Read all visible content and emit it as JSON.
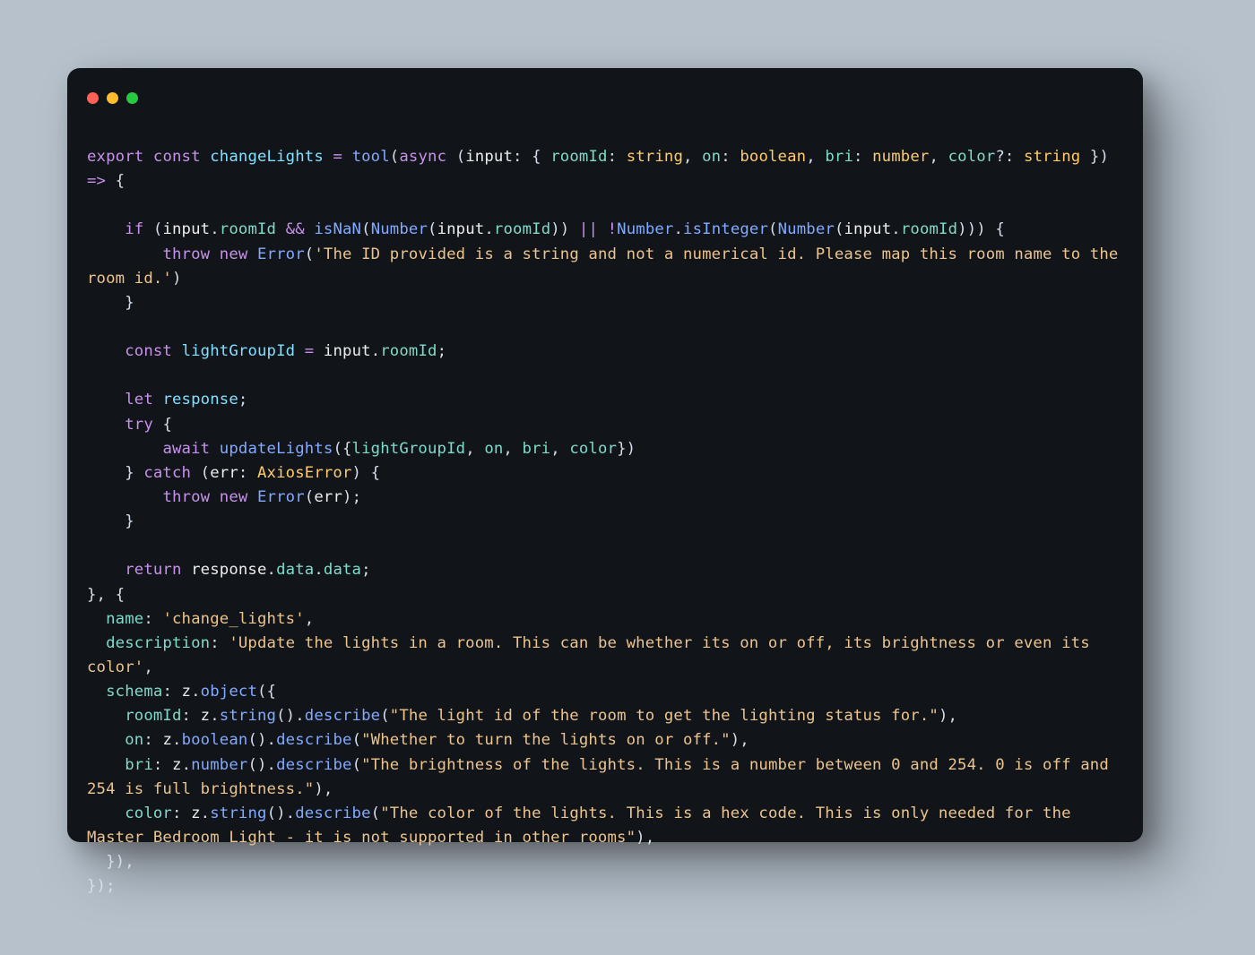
{
  "window": {
    "traffic_lights": [
      "close",
      "minimize",
      "zoom"
    ]
  },
  "code": {
    "tokens": [
      {
        "t": "export",
        "c": "kw"
      },
      {
        "t": " ",
        "c": "punc"
      },
      {
        "t": "const",
        "c": "kw"
      },
      {
        "t": " ",
        "c": "punc"
      },
      {
        "t": "changeLights",
        "c": "decl"
      },
      {
        "t": " ",
        "c": "punc"
      },
      {
        "t": "=",
        "c": "op"
      },
      {
        "t": " ",
        "c": "punc"
      },
      {
        "t": "tool",
        "c": "fn"
      },
      {
        "t": "(",
        "c": "punc"
      },
      {
        "t": "async",
        "c": "kw"
      },
      {
        "t": " (",
        "c": "punc"
      },
      {
        "t": "input",
        "c": "var"
      },
      {
        "t": ": { ",
        "c": "punc"
      },
      {
        "t": "roomId",
        "c": "prop"
      },
      {
        "t": ": ",
        "c": "punc"
      },
      {
        "t": "string",
        "c": "typ"
      },
      {
        "t": ", ",
        "c": "punc"
      },
      {
        "t": "on",
        "c": "prop"
      },
      {
        "t": ": ",
        "c": "punc"
      },
      {
        "t": "boolean",
        "c": "typ"
      },
      {
        "t": ", ",
        "c": "punc"
      },
      {
        "t": "bri",
        "c": "prop"
      },
      {
        "t": ": ",
        "c": "punc"
      },
      {
        "t": "number",
        "c": "typ"
      },
      {
        "t": ", ",
        "c": "punc"
      },
      {
        "t": "color",
        "c": "prop"
      },
      {
        "t": "?: ",
        "c": "punc"
      },
      {
        "t": "string",
        "c": "typ"
      },
      {
        "t": " }) ",
        "c": "punc"
      },
      {
        "t": "=>",
        "c": "op"
      },
      {
        "t": " {",
        "c": "punc"
      },
      {
        "t": "\n\n    ",
        "c": "punc"
      },
      {
        "t": "if",
        "c": "kw"
      },
      {
        "t": " (",
        "c": "punc"
      },
      {
        "t": "input",
        "c": "var"
      },
      {
        "t": ".",
        "c": "punc"
      },
      {
        "t": "roomId",
        "c": "prop"
      },
      {
        "t": " ",
        "c": "punc"
      },
      {
        "t": "&&",
        "c": "op"
      },
      {
        "t": " ",
        "c": "punc"
      },
      {
        "t": "isNaN",
        "c": "fn"
      },
      {
        "t": "(",
        "c": "punc"
      },
      {
        "t": "Number",
        "c": "fn"
      },
      {
        "t": "(",
        "c": "punc"
      },
      {
        "t": "input",
        "c": "var"
      },
      {
        "t": ".",
        "c": "punc"
      },
      {
        "t": "roomId",
        "c": "prop"
      },
      {
        "t": ")) ",
        "c": "punc"
      },
      {
        "t": "||",
        "c": "op"
      },
      {
        "t": " ",
        "c": "punc"
      },
      {
        "t": "!",
        "c": "op"
      },
      {
        "t": "Number",
        "c": "fn"
      },
      {
        "t": ".",
        "c": "punc"
      },
      {
        "t": "isInteger",
        "c": "fn"
      },
      {
        "t": "(",
        "c": "punc"
      },
      {
        "t": "Number",
        "c": "fn"
      },
      {
        "t": "(",
        "c": "punc"
      },
      {
        "t": "input",
        "c": "var"
      },
      {
        "t": ".",
        "c": "punc"
      },
      {
        "t": "roomId",
        "c": "prop"
      },
      {
        "t": "))) {",
        "c": "punc"
      },
      {
        "t": "\n        ",
        "c": "punc"
      },
      {
        "t": "throw",
        "c": "kw"
      },
      {
        "t": " ",
        "c": "punc"
      },
      {
        "t": "new",
        "c": "kw"
      },
      {
        "t": " ",
        "c": "punc"
      },
      {
        "t": "Error",
        "c": "fn"
      },
      {
        "t": "(",
        "c": "punc"
      },
      {
        "t": "'The ID provided is a string and not a numerical id. Please map this room name to the room id.'",
        "c": "str"
      },
      {
        "t": ")",
        "c": "punc"
      },
      {
        "t": "\n    }",
        "c": "punc"
      },
      {
        "t": "\n\n    ",
        "c": "punc"
      },
      {
        "t": "const",
        "c": "kw"
      },
      {
        "t": " ",
        "c": "punc"
      },
      {
        "t": "lightGroupId",
        "c": "decl"
      },
      {
        "t": " ",
        "c": "punc"
      },
      {
        "t": "=",
        "c": "op"
      },
      {
        "t": " ",
        "c": "punc"
      },
      {
        "t": "input",
        "c": "var"
      },
      {
        "t": ".",
        "c": "punc"
      },
      {
        "t": "roomId",
        "c": "prop"
      },
      {
        "t": ";",
        "c": "punc"
      },
      {
        "t": "\n\n    ",
        "c": "punc"
      },
      {
        "t": "let",
        "c": "kw"
      },
      {
        "t": " ",
        "c": "punc"
      },
      {
        "t": "response",
        "c": "decl"
      },
      {
        "t": ";",
        "c": "punc"
      },
      {
        "t": "\n    ",
        "c": "punc"
      },
      {
        "t": "try",
        "c": "kw"
      },
      {
        "t": " {",
        "c": "punc"
      },
      {
        "t": "\n        ",
        "c": "punc"
      },
      {
        "t": "await",
        "c": "kw"
      },
      {
        "t": " ",
        "c": "punc"
      },
      {
        "t": "updateLights",
        "c": "fn"
      },
      {
        "t": "({",
        "c": "punc"
      },
      {
        "t": "lightGroupId",
        "c": "prop"
      },
      {
        "t": ", ",
        "c": "punc"
      },
      {
        "t": "on",
        "c": "prop"
      },
      {
        "t": ", ",
        "c": "punc"
      },
      {
        "t": "bri",
        "c": "prop"
      },
      {
        "t": ", ",
        "c": "punc"
      },
      {
        "t": "color",
        "c": "prop"
      },
      {
        "t": "})",
        "c": "punc"
      },
      {
        "t": "\n    } ",
        "c": "punc"
      },
      {
        "t": "catch",
        "c": "kw"
      },
      {
        "t": " (",
        "c": "punc"
      },
      {
        "t": "err",
        "c": "var"
      },
      {
        "t": ": ",
        "c": "punc"
      },
      {
        "t": "AxiosError",
        "c": "typ"
      },
      {
        "t": ") {",
        "c": "punc"
      },
      {
        "t": "\n        ",
        "c": "punc"
      },
      {
        "t": "throw",
        "c": "kw"
      },
      {
        "t": " ",
        "c": "punc"
      },
      {
        "t": "new",
        "c": "kw"
      },
      {
        "t": " ",
        "c": "punc"
      },
      {
        "t": "Error",
        "c": "fn"
      },
      {
        "t": "(",
        "c": "punc"
      },
      {
        "t": "err",
        "c": "var"
      },
      {
        "t": ");",
        "c": "punc"
      },
      {
        "t": "\n    }",
        "c": "punc"
      },
      {
        "t": "\n\n    ",
        "c": "punc"
      },
      {
        "t": "return",
        "c": "kw"
      },
      {
        "t": " ",
        "c": "punc"
      },
      {
        "t": "response",
        "c": "var"
      },
      {
        "t": ".",
        "c": "punc"
      },
      {
        "t": "data",
        "c": "prop"
      },
      {
        "t": ".",
        "c": "punc"
      },
      {
        "t": "data",
        "c": "prop"
      },
      {
        "t": ";",
        "c": "punc"
      },
      {
        "t": "\n}, {",
        "c": "punc"
      },
      {
        "t": "\n  ",
        "c": "punc"
      },
      {
        "t": "name",
        "c": "prop"
      },
      {
        "t": ": ",
        "c": "punc"
      },
      {
        "t": "'change_lights'",
        "c": "str"
      },
      {
        "t": ",",
        "c": "punc"
      },
      {
        "t": "\n  ",
        "c": "punc"
      },
      {
        "t": "description",
        "c": "prop"
      },
      {
        "t": ": ",
        "c": "punc"
      },
      {
        "t": "'Update the lights in a room. This can be whether its on or off, its brightness or even its color'",
        "c": "str"
      },
      {
        "t": ",",
        "c": "punc"
      },
      {
        "t": "\n  ",
        "c": "punc"
      },
      {
        "t": "schema",
        "c": "prop"
      },
      {
        "t": ": ",
        "c": "punc"
      },
      {
        "t": "z",
        "c": "var"
      },
      {
        "t": ".",
        "c": "punc"
      },
      {
        "t": "object",
        "c": "fn"
      },
      {
        "t": "({",
        "c": "punc"
      },
      {
        "t": "\n    ",
        "c": "punc"
      },
      {
        "t": "roomId",
        "c": "prop"
      },
      {
        "t": ": ",
        "c": "punc"
      },
      {
        "t": "z",
        "c": "var"
      },
      {
        "t": ".",
        "c": "punc"
      },
      {
        "t": "string",
        "c": "fn"
      },
      {
        "t": "().",
        "c": "punc"
      },
      {
        "t": "describe",
        "c": "fn"
      },
      {
        "t": "(",
        "c": "punc"
      },
      {
        "t": "\"The light id of the room to get the lighting status for.\"",
        "c": "str"
      },
      {
        "t": "),",
        "c": "punc"
      },
      {
        "t": "\n    ",
        "c": "punc"
      },
      {
        "t": "on",
        "c": "prop"
      },
      {
        "t": ": ",
        "c": "punc"
      },
      {
        "t": "z",
        "c": "var"
      },
      {
        "t": ".",
        "c": "punc"
      },
      {
        "t": "boolean",
        "c": "fn"
      },
      {
        "t": "().",
        "c": "punc"
      },
      {
        "t": "describe",
        "c": "fn"
      },
      {
        "t": "(",
        "c": "punc"
      },
      {
        "t": "\"Whether to turn the lights on or off.\"",
        "c": "str"
      },
      {
        "t": "),",
        "c": "punc"
      },
      {
        "t": "\n    ",
        "c": "punc"
      },
      {
        "t": "bri",
        "c": "prop"
      },
      {
        "t": ": ",
        "c": "punc"
      },
      {
        "t": "z",
        "c": "var"
      },
      {
        "t": ".",
        "c": "punc"
      },
      {
        "t": "number",
        "c": "fn"
      },
      {
        "t": "().",
        "c": "punc"
      },
      {
        "t": "describe",
        "c": "fn"
      },
      {
        "t": "(",
        "c": "punc"
      },
      {
        "t": "\"The brightness of the lights. This is a number between 0 and 254. 0 is off and 254 is full brightness.\"",
        "c": "str"
      },
      {
        "t": "),",
        "c": "punc"
      },
      {
        "t": "\n    ",
        "c": "punc"
      },
      {
        "t": "color",
        "c": "prop"
      },
      {
        "t": ": ",
        "c": "punc"
      },
      {
        "t": "z",
        "c": "var"
      },
      {
        "t": ".",
        "c": "punc"
      },
      {
        "t": "string",
        "c": "fn"
      },
      {
        "t": "().",
        "c": "punc"
      },
      {
        "t": "describe",
        "c": "fn"
      },
      {
        "t": "(",
        "c": "punc"
      },
      {
        "t": "\"The color of the lights. This is a hex code. This is only needed for the Master Bedroom Light - it is not supported in other rooms\"",
        "c": "str"
      },
      {
        "t": "),",
        "c": "punc"
      },
      {
        "t": "\n  }),",
        "c": "punc"
      },
      {
        "t": "\n});",
        "c": "punc"
      }
    ]
  }
}
